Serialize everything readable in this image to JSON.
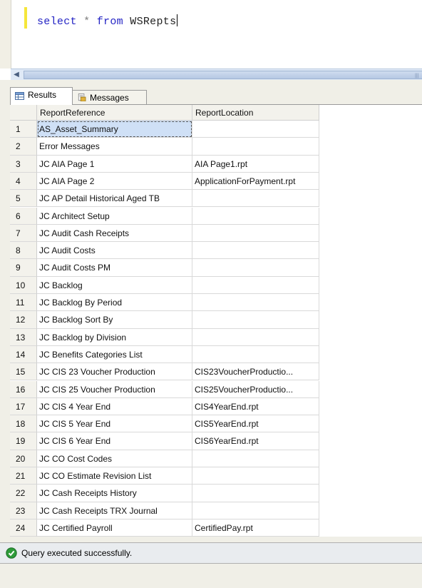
{
  "editor": {
    "query_keyword_select": "select",
    "query_operator": "*",
    "query_keyword_from": "from",
    "query_table": "WSRepts"
  },
  "tabs": [
    {
      "label": "Results",
      "icon": "grid-icon",
      "active": true
    },
    {
      "label": "Messages",
      "icon": "messages-icon",
      "active": false
    }
  ],
  "grid": {
    "columns": [
      "ReportReference",
      "ReportLocation"
    ],
    "rows": [
      {
        "num": "1",
        "ref": "AS_Asset_Summary",
        "loc": ""
      },
      {
        "num": "2",
        "ref": "Error Messages",
        "loc": ""
      },
      {
        "num": "3",
        "ref": "JC AIA Page 1",
        "loc": "AIA Page1.rpt"
      },
      {
        "num": "4",
        "ref": "JC AIA Page 2",
        "loc": "ApplicationForPayment.rpt"
      },
      {
        "num": "5",
        "ref": "JC AP Detail Historical Aged TB",
        "loc": ""
      },
      {
        "num": "6",
        "ref": "JC Architect Setup",
        "loc": ""
      },
      {
        "num": "7",
        "ref": "JC Audit Cash Receipts",
        "loc": ""
      },
      {
        "num": "8",
        "ref": "JC Audit Costs",
        "loc": ""
      },
      {
        "num": "9",
        "ref": "JC Audit Costs PM",
        "loc": ""
      },
      {
        "num": "10",
        "ref": "JC Backlog",
        "loc": ""
      },
      {
        "num": "11",
        "ref": "JC Backlog By Period",
        "loc": ""
      },
      {
        "num": "12",
        "ref": "JC Backlog Sort By",
        "loc": ""
      },
      {
        "num": "13",
        "ref": "JC Backlog by Division",
        "loc": ""
      },
      {
        "num": "14",
        "ref": "JC Benefits Categories List",
        "loc": ""
      },
      {
        "num": "15",
        "ref": "JC CIS 23 Voucher Production",
        "loc": "CIS23VoucherProductio..."
      },
      {
        "num": "16",
        "ref": "JC CIS 25 Voucher Production",
        "loc": "CIS25VoucherProductio..."
      },
      {
        "num": "17",
        "ref": "JC CIS 4 Year End",
        "loc": "CIS4YearEnd.rpt"
      },
      {
        "num": "18",
        "ref": "JC CIS 5 Year End",
        "loc": "CIS5YearEnd.rpt"
      },
      {
        "num": "19",
        "ref": "JC CIS 6 Year End",
        "loc": "CIS6YearEnd.rpt"
      },
      {
        "num": "20",
        "ref": "JC CO Cost Codes",
        "loc": ""
      },
      {
        "num": "21",
        "ref": "JC CO Estimate Revision List",
        "loc": ""
      },
      {
        "num": "22",
        "ref": "JC Cash Receipts History",
        "loc": ""
      },
      {
        "num": "23",
        "ref": "JC Cash Receipts TRX Journal",
        "loc": ""
      },
      {
        "num": "24",
        "ref": "JC Certified Payroll",
        "loc": "CertifiedPay.rpt"
      }
    ]
  },
  "status": {
    "text": "Query executed successfully.",
    "icon": "success-check-icon",
    "icon_color": "#2e9b3a"
  }
}
